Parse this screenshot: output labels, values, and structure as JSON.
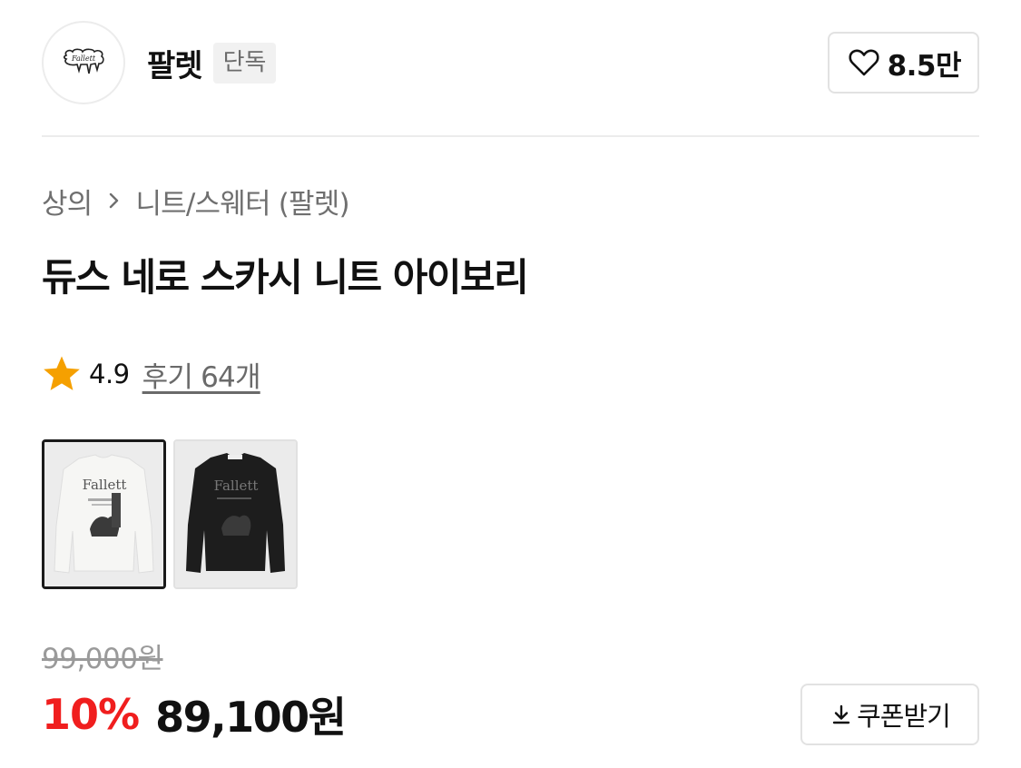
{
  "brand": {
    "logo_icon": "fallett-logo-icon",
    "logo_text": "Fallett",
    "name": "팔렛",
    "badge": "단독",
    "like_icon": "heart-outline-icon",
    "like_count": "8.5만"
  },
  "breadcrumb": {
    "items": [
      "상의",
      "니트/스웨터 (팔렛)"
    ],
    "separator_icon": "chevron-right-icon"
  },
  "product": {
    "title": "듀스 네로 스카시 니트 아이보리"
  },
  "rating": {
    "star_icon": "star-filled-icon",
    "star_color": "#F5A000",
    "value": "4.9",
    "review_text": "후기 64개"
  },
  "thumbnails": [
    {
      "name": "ivory-sweater",
      "color": "#f4f4f2",
      "selected": true
    },
    {
      "name": "black-sweater",
      "color": "#1c1c1c",
      "selected": false
    }
  ],
  "price": {
    "original": "99,000원",
    "discount": "10%",
    "discount_color": "#F01E1E",
    "sale": "89,100원"
  },
  "coupon": {
    "icon": "download-icon",
    "label": "쿠폰받기"
  }
}
